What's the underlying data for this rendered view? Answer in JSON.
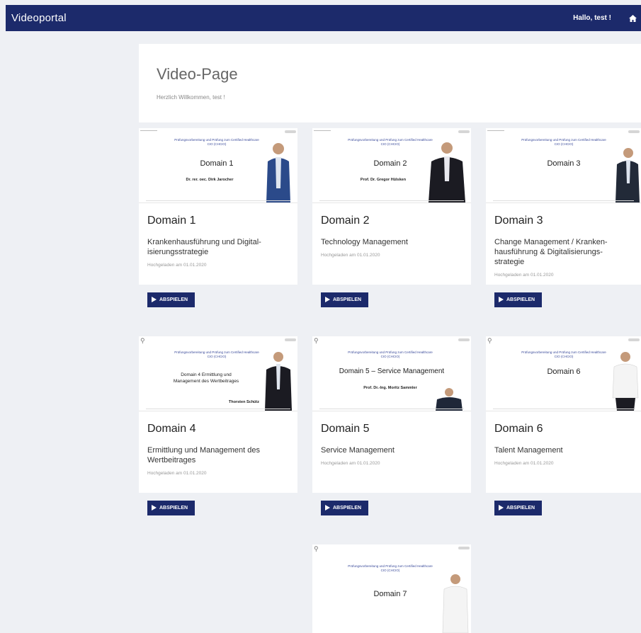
{
  "header": {
    "brand": "Videoportal",
    "greeting": "Hallo, test !",
    "home_icon": "home-icon"
  },
  "intro": {
    "title": "Video-Page",
    "welcome": "Herzlich Willkommen, test !"
  },
  "play_label": "ABSPIELEN",
  "cards": [
    {
      "title": "Domain 1",
      "subtitle": "Krankenhausführung und Digital-isierungsstrategie",
      "meta": "Hochgeladen am 01.01.2020",
      "slide_domain": "Domain 1",
      "slide_head": "Prüfungsvorbereitung und Prüfung zum Certified Healthcare CIO (CHCIO)",
      "slide_sub": "Dr. rer. oec. Dirk Jarocher"
    },
    {
      "title": "Domain 2",
      "subtitle": "Technology Management",
      "meta": "Hochgeladen am 01.01.2020",
      "slide_domain": "Domain 2",
      "slide_head": "Prüfungsvorbereitung und Prüfung zum Certified Healthcare CIO (CHCIO)",
      "slide_sub": "Prof. Dr. Gregor Hülsken"
    },
    {
      "title": "Domain 3",
      "subtitle": "Change Management / Kranken-hausführung & Digitalisierungs-strategie",
      "meta": "Hochgeladen am 01.01.2020",
      "slide_domain": "Domain 3",
      "slide_head": "Prüfungsvorbereitung und Prüfung zum Certified Healthcare CIO (CHCIO)",
      "slide_sub": ""
    },
    {
      "title": "Domain 4",
      "subtitle": "Ermittlung und Management des Wertbeitrages",
      "meta": "Hochgeladen am 01.01.2020",
      "slide_domain": "Domain 4 Ermittlung und Management des Wertbeitrages",
      "slide_head": "Prüfungsvorbereitung und Prüfung zum Certified Healthcare CIO (CHCIO)",
      "slide_sub": "Thorsten Schütz"
    },
    {
      "title": "Domain 5",
      "subtitle": "Service Management",
      "meta": "Hochgeladen am 01.01.2020",
      "slide_domain": "Domain 5 – Service Management",
      "slide_head": "Prüfungsvorbereitung und Prüfung zum Certified Healthcare CIO (CHCIO)",
      "slide_sub": "Prof. Dr.-Ing. Moritz Sammler"
    },
    {
      "title": "Domain 6",
      "subtitle": "Talent Management",
      "meta": "Hochgeladen am 01.01.2020",
      "slide_domain": "Domain 6",
      "slide_head": "Prüfungsvorbereitung und Prüfung zum Certified Healthcare CIO (CHCIO)",
      "slide_sub": ""
    },
    {
      "title": "",
      "subtitle": "",
      "meta": "",
      "slide_domain": "Domain 7",
      "slide_head": "Prüfungsvorbereitung und Prüfung zum Certified Healthcare CIO (CHCIO)",
      "slide_sub": ""
    }
  ],
  "colors": {
    "navbar": "#1c2a6b",
    "button": "#1c2a6b",
    "background": "#eef0f4"
  }
}
